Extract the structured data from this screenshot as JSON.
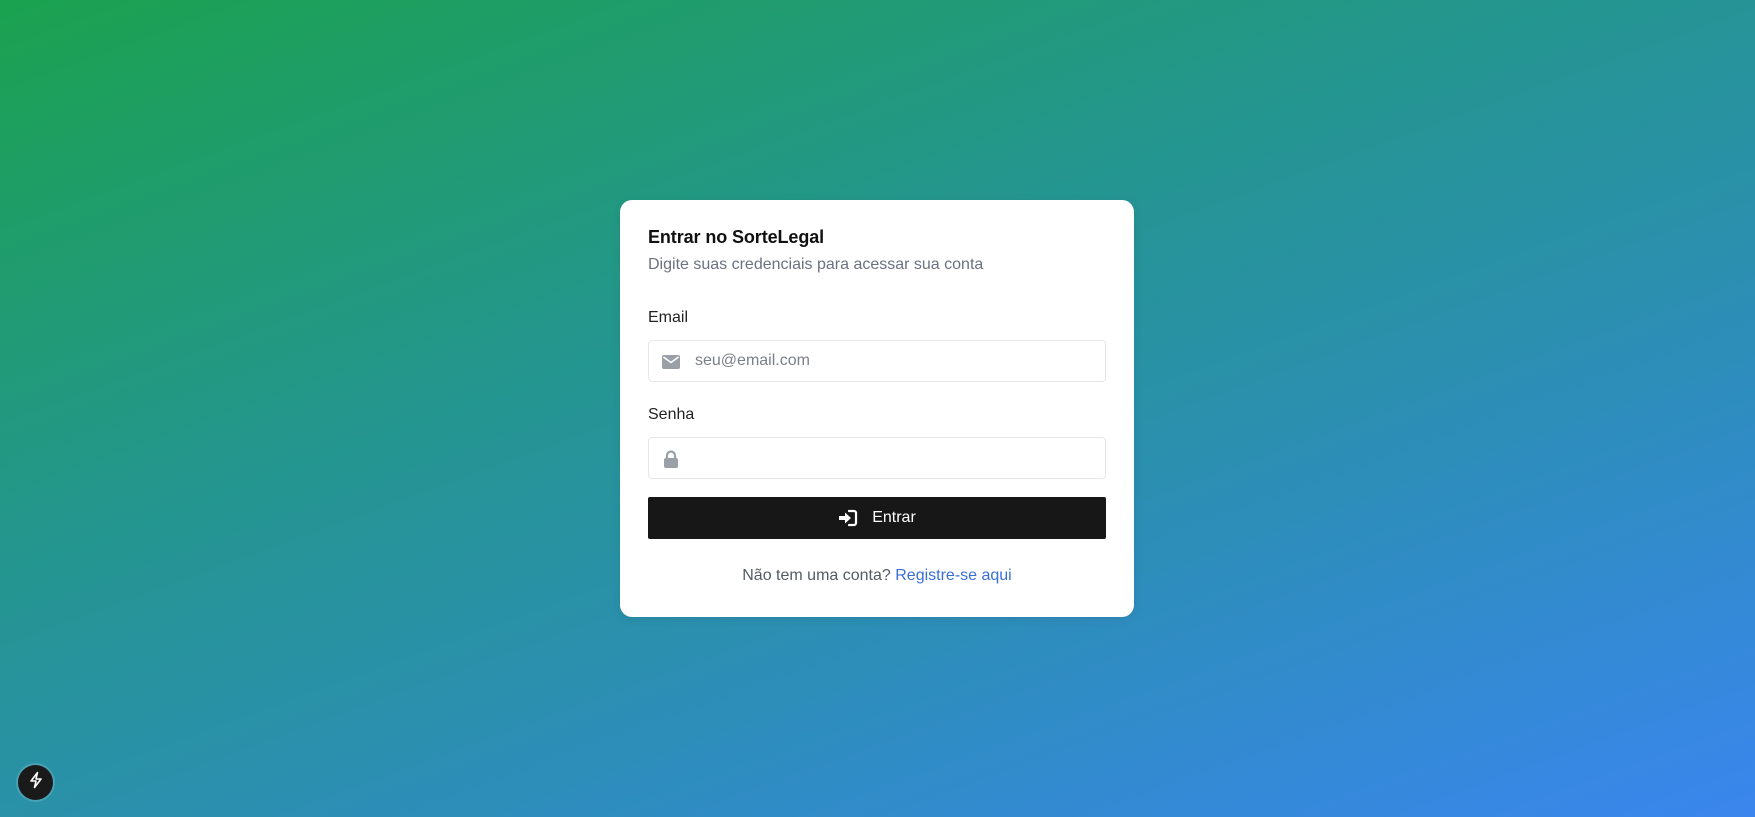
{
  "login": {
    "title": "Entrar no SorteLegal",
    "subtitle": "Digite suas credenciais para acessar sua conta",
    "email": {
      "label": "Email",
      "placeholder": "seu@email.com",
      "value": "",
      "icon": "envelope-icon"
    },
    "password": {
      "label": "Senha",
      "placeholder": "",
      "value": "",
      "icon": "lock-icon"
    },
    "submit": {
      "label": "Entrar",
      "icon": "sign-in-icon"
    },
    "footer": {
      "text": "Não tem uma conta?",
      "link_label": "Registre-se aqui"
    }
  },
  "dev_tools": {
    "icon": "lightning-bolt-icon"
  },
  "colors": {
    "background_start": "#1ba24f",
    "background_end": "#3a86ee",
    "card": "#ffffff",
    "button": "#171717",
    "link": "#3b6fd6"
  }
}
